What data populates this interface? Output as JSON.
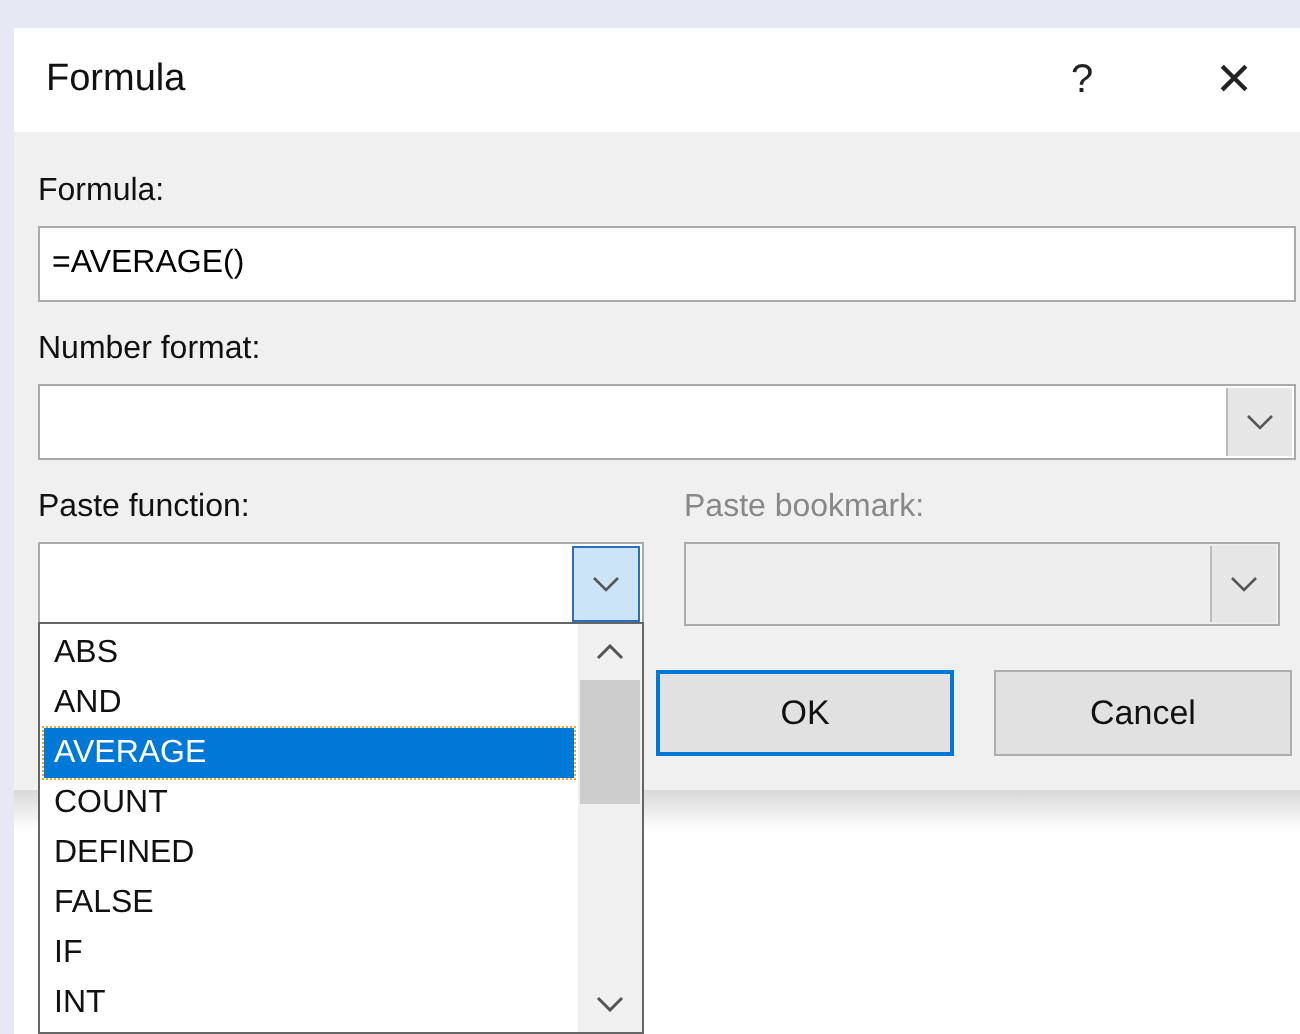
{
  "window": {
    "title": "Formula",
    "help": "?",
    "close": "×"
  },
  "formula": {
    "label": "Formula:",
    "value": "=AVERAGE()"
  },
  "number_format": {
    "label": "Number format:",
    "expanded": false
  },
  "paste_function": {
    "label": "Paste function:",
    "expanded": true,
    "items": [
      {
        "label": "ABS",
        "selected": false
      },
      {
        "label": "AND",
        "selected": false
      },
      {
        "label": "AVERAGE",
        "selected": true
      },
      {
        "label": "COUNT",
        "selected": false
      },
      {
        "label": "DEFINED",
        "selected": false
      },
      {
        "label": "FALSE",
        "selected": false
      },
      {
        "label": "IF",
        "selected": false
      },
      {
        "label": "INT",
        "selected": false
      }
    ]
  },
  "paste_bookmark": {
    "label": "Paste bookmark:",
    "disabled": true
  },
  "buttons": [
    {
      "label": "OK",
      "default": true
    },
    {
      "label": "Cancel",
      "default": false
    }
  ]
}
